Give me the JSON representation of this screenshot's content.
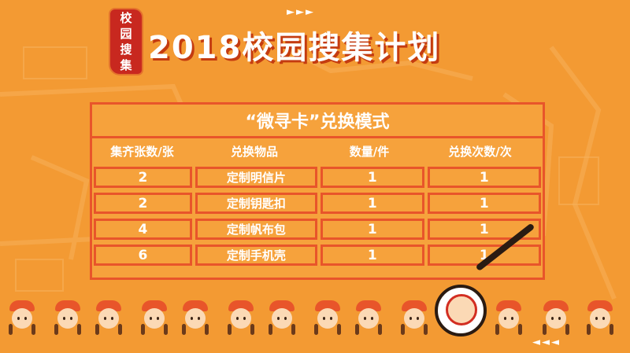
{
  "stamp": {
    "chars": [
      "校",
      "园",
      "搜",
      "集"
    ]
  },
  "title": "2018校园搜集计划",
  "decor": {
    "arrows_top": "►►►",
    "arrows_bottom": "◄◄◄"
  },
  "table": {
    "title": "“微寻卡”兑换模式",
    "headers": [
      "集齐张数/张",
      "兑换物品",
      "数量/件",
      "兑换次数/次"
    ],
    "rows": [
      [
        "2",
        "定制明信片",
        "1",
        "1"
      ],
      [
        "2",
        "定制钥匙扣",
        "1",
        "1"
      ],
      [
        "4",
        "定制帆布包",
        "1",
        "1"
      ],
      [
        "6",
        "定制手机壳",
        "1",
        "1"
      ]
    ]
  },
  "colors": {
    "background": "#f39a33",
    "border": "#e8552a",
    "title_shadow": "#c43b10",
    "stamp": "#c8281f"
  },
  "icons": {
    "magnifier": "magnifier-icon",
    "character": "girl-character-icon"
  }
}
